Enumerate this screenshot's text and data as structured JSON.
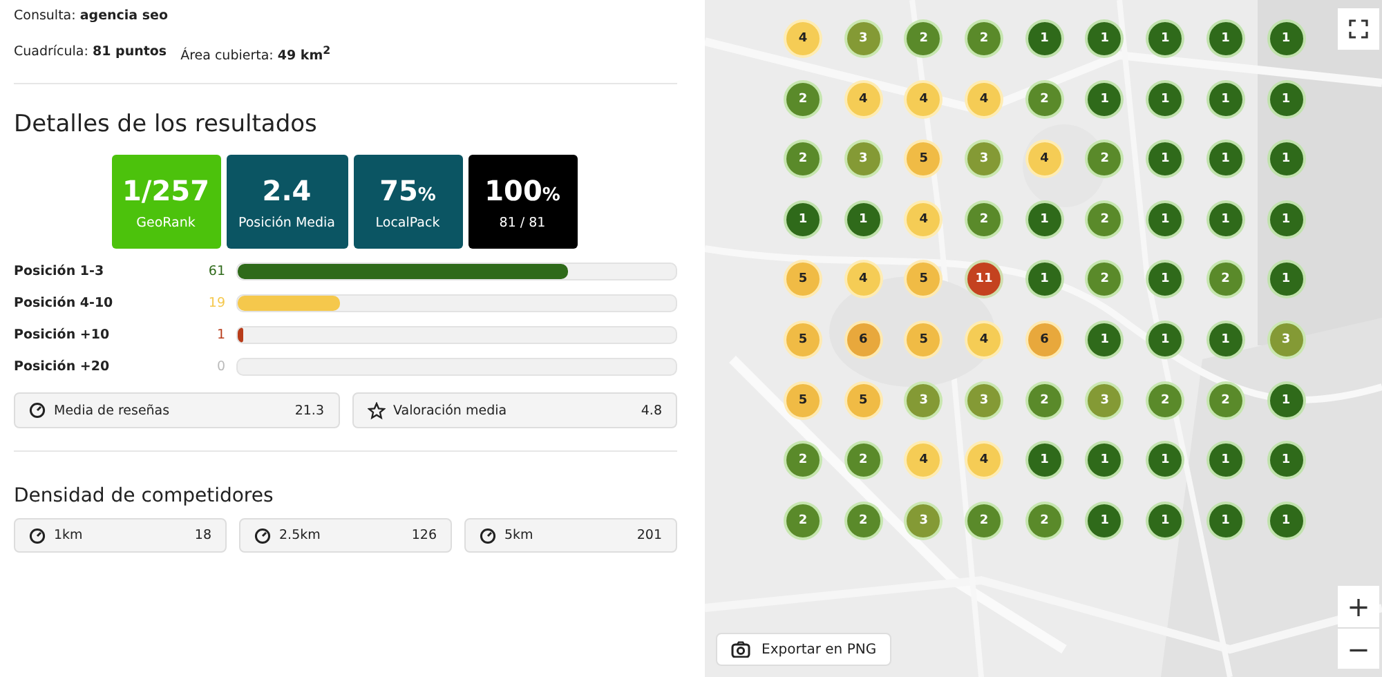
{
  "query": {
    "label": "Consulta:",
    "value": "agencia seo"
  },
  "grid": {
    "label": "Cuadrícula:",
    "value": "81 puntos",
    "area_label": "Área cubierta:",
    "area_value": "49 km$^{2}$"
  },
  "results": {
    "title": "Detalles de los resultados",
    "cards": [
      {
        "value": "1/257",
        "caption": "GeoRank",
        "color": "#4cc20c"
      },
      {
        "value": "2.4",
        "caption": "Posición Media",
        "color": "#0b5563"
      },
      {
        "value": "75",
        "unit": "%",
        "caption": "LocalPack",
        "color": "#0b5563"
      },
      {
        "value": "100",
        "unit": "%",
        "caption": "81 / 81",
        "color": "#000000"
      }
    ],
    "positions": [
      {
        "label": "Posición 1-3",
        "count": "61",
        "level": 0.753,
        "color": "#2f6a1a"
      },
      {
        "label": "Posición 4-10",
        "count": "19",
        "level": 0.235,
        "color": "#f5c84c"
      },
      {
        "label": "Posición +10",
        "count": "1",
        "level": 0.012,
        "color": "#b83c1a"
      },
      {
        "label": "Posición +20",
        "count": "0",
        "color": "#bbbbbb"
      }
    ],
    "metrics": [
      {
        "kind": "gauge",
        "label": "Media de reseñas",
        "value": "21.3"
      },
      {
        "kind": "star",
        "label": "Valoración media",
        "value": "4.8"
      }
    ]
  },
  "competitors": {
    "title": "Densidad de competidores",
    "items": [
      {
        "label": "1km",
        "value": "18"
      },
      {
        "label": "2.5km",
        "value": "126"
      },
      {
        "label": "5km",
        "value": "201"
      }
    ]
  },
  "map": {
    "export_button": "Exportar en PNG",
    "zoom_in": "+",
    "zoom_out": "−",
    "rows": [
      {
        "pins": [
          {
            "rank": "4",
            "color": "#f5cc55"
          },
          {
            "rank": "3",
            "color": "#849a35"
          },
          {
            "rank": "2",
            "color": "#5a8a2a"
          },
          {
            "rank": "2",
            "color": "#5a8a2a"
          },
          {
            "rank": "1",
            "color": "#2f6a1a"
          },
          {
            "rank": "1",
            "color": "#2f6a1a"
          },
          {
            "rank": "1",
            "color": "#2f6a1a"
          },
          {
            "rank": "1",
            "color": "#2f6a1a"
          },
          {
            "rank": "1",
            "color": "#2f6a1a"
          }
        ]
      },
      {
        "pins": [
          {
            "rank": "2",
            "color": "#5a8a2a"
          },
          {
            "rank": "4",
            "color": "#f5cc55"
          },
          {
            "rank": "4",
            "color": "#f5cc55"
          },
          {
            "rank": "4",
            "color": "#f5cc55"
          },
          {
            "rank": "2",
            "color": "#5a8a2a"
          },
          {
            "rank": "1",
            "color": "#2f6a1a"
          },
          {
            "rank": "1",
            "color": "#2f6a1a"
          },
          {
            "rank": "1",
            "color": "#2f6a1a"
          },
          {
            "rank": "1",
            "color": "#2f6a1a"
          }
        ]
      },
      {
        "pins": [
          {
            "rank": "2",
            "color": "#5a8a2a"
          },
          {
            "rank": "3",
            "color": "#849a35"
          },
          {
            "rank": "5",
            "color": "#f0bb45"
          },
          {
            "rank": "3",
            "color": "#849a35"
          },
          {
            "rank": "4",
            "color": "#f5cc55"
          },
          {
            "rank": "2",
            "color": "#5a8a2a"
          },
          {
            "rank": "1",
            "color": "#2f6a1a"
          },
          {
            "rank": "1",
            "color": "#2f6a1a"
          },
          {
            "rank": "1",
            "color": "#2f6a1a"
          }
        ]
      },
      {
        "pins": [
          {
            "rank": "1",
            "color": "#2f6a1a"
          },
          {
            "rank": "1",
            "color": "#2f6a1a"
          },
          {
            "rank": "4",
            "color": "#f5cc55"
          },
          {
            "rank": "2",
            "color": "#5a8a2a"
          },
          {
            "rank": "1",
            "color": "#2f6a1a"
          },
          {
            "rank": "2",
            "color": "#5a8a2a"
          },
          {
            "rank": "1",
            "color": "#2f6a1a"
          },
          {
            "rank": "1",
            "color": "#2f6a1a"
          },
          {
            "rank": "1",
            "color": "#2f6a1a"
          }
        ]
      },
      {
        "pins": [
          {
            "rank": "5",
            "color": "#f0bb45"
          },
          {
            "rank": "4",
            "color": "#f5cc55"
          },
          {
            "rank": "5",
            "color": "#f0bb45"
          },
          {
            "rank": "11",
            "color": "#c4421f"
          },
          {
            "rank": "1",
            "color": "#2f6a1a"
          },
          {
            "rank": "2",
            "color": "#5a8a2a"
          },
          {
            "rank": "1",
            "color": "#2f6a1a"
          },
          {
            "rank": "2",
            "color": "#5a8a2a"
          },
          {
            "rank": "1",
            "color": "#2f6a1a"
          }
        ]
      },
      {
        "pins": [
          {
            "rank": "5",
            "color": "#f0bb45"
          },
          {
            "rank": "6",
            "color": "#e8a83c"
          },
          {
            "rank": "5",
            "color": "#f0bb45"
          },
          {
            "rank": "4",
            "color": "#f5cc55"
          },
          {
            "rank": "6",
            "color": "#e8a83c"
          },
          {
            "rank": "1",
            "color": "#2f6a1a"
          },
          {
            "rank": "1",
            "color": "#2f6a1a"
          },
          {
            "rank": "1",
            "color": "#2f6a1a"
          },
          {
            "rank": "3",
            "color": "#849a35"
          }
        ]
      },
      {
        "pins": [
          {
            "rank": "5",
            "color": "#f0bb45"
          },
          {
            "rank": "5",
            "color": "#f0bb45"
          },
          {
            "rank": "3",
            "color": "#849a35"
          },
          {
            "rank": "3",
            "color": "#849a35"
          },
          {
            "rank": "2",
            "color": "#5a8a2a"
          },
          {
            "rank": "3",
            "color": "#849a35"
          },
          {
            "rank": "2",
            "color": "#5a8a2a"
          },
          {
            "rank": "2",
            "color": "#5a8a2a"
          },
          {
            "rank": "1",
            "color": "#2f6a1a"
          }
        ]
      },
      {
        "pins": [
          {
            "rank": "2",
            "color": "#5a8a2a"
          },
          {
            "rank": "2",
            "color": "#5a8a2a"
          },
          {
            "rank": "4",
            "color": "#f5cc55"
          },
          {
            "rank": "4",
            "color": "#f5cc55"
          },
          {
            "rank": "1",
            "color": "#2f6a1a"
          },
          {
            "rank": "1",
            "color": "#2f6a1a"
          },
          {
            "rank": "1",
            "color": "#2f6a1a"
          },
          {
            "rank": "1",
            "color": "#2f6a1a"
          },
          {
            "rank": "1",
            "color": "#2f6a1a"
          }
        ]
      },
      {
        "pins": [
          {
            "rank": "2",
            "color": "#5a8a2a"
          },
          {
            "rank": "2",
            "color": "#5a8a2a"
          },
          {
            "rank": "3",
            "color": "#849a35"
          },
          {
            "rank": "2",
            "color": "#5a8a2a"
          },
          {
            "rank": "2",
            "color": "#5a8a2a"
          },
          {
            "rank": "1",
            "color": "#2f6a1a"
          },
          {
            "rank": "1",
            "color": "#2f6a1a"
          },
          {
            "rank": "1",
            "color": "#2f6a1a"
          },
          {
            "rank": "1",
            "color": "#2f6a1a"
          }
        ]
      }
    ]
  }
}
